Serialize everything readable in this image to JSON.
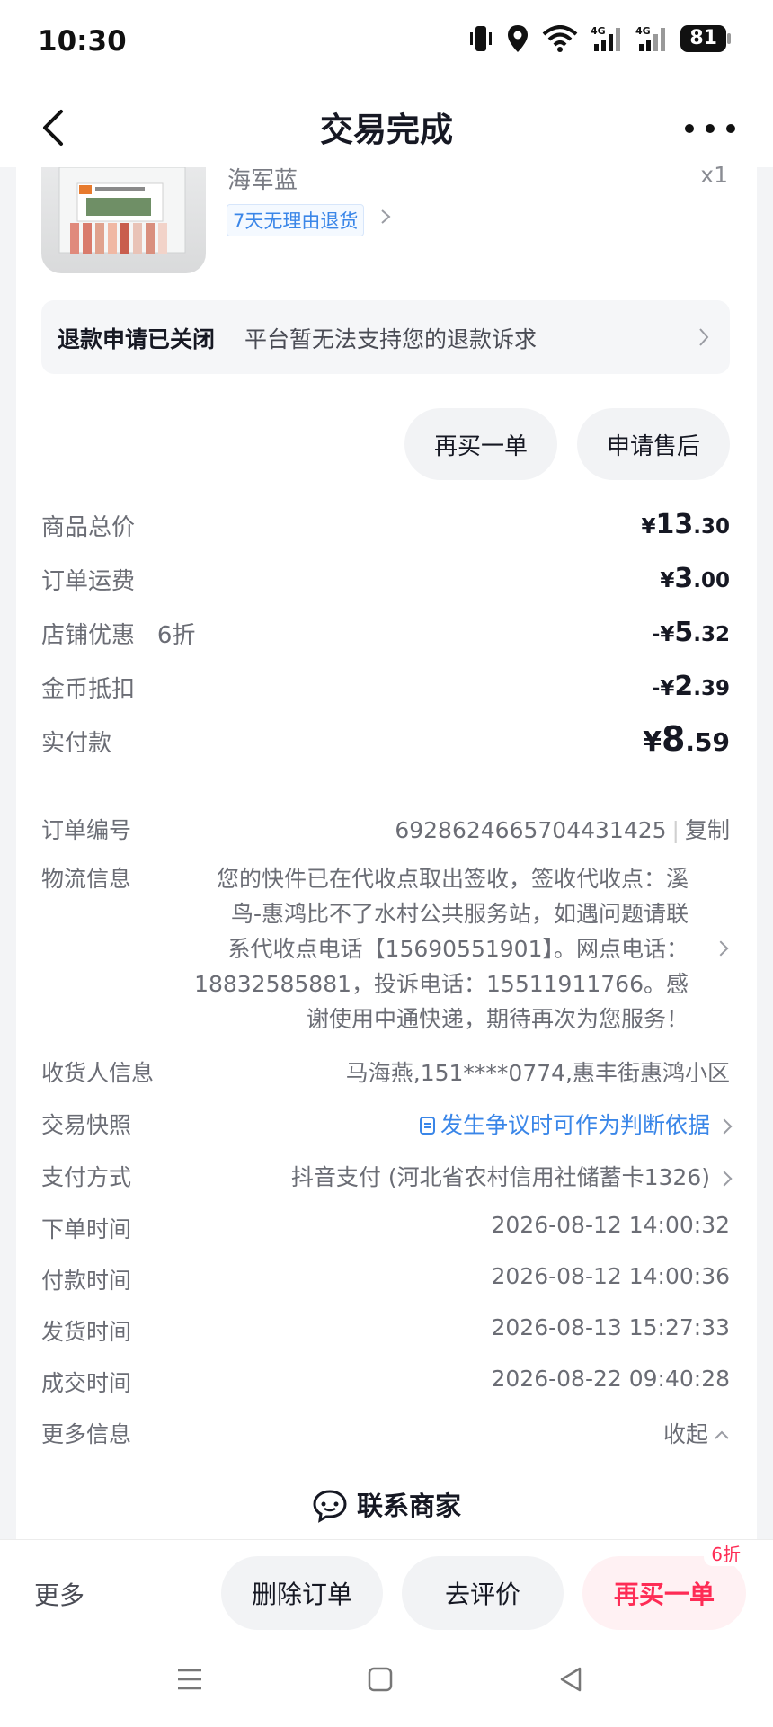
{
  "status_bar": {
    "time": "10:30",
    "battery": "81"
  },
  "header": {
    "title": "交易完成"
  },
  "product": {
    "name": "海军蓝",
    "quantity": "x1",
    "return_tag": "7天无理由退货"
  },
  "refund": {
    "status": "退款申请已关闭",
    "reason": "平台暂无法支持您的退款诉求"
  },
  "actions": {
    "buy_again": "再买一单",
    "after_sale": "申请售后"
  },
  "prices": [
    {
      "label": "商品总价",
      "extra": "",
      "prefix": "¥",
      "int": "13",
      "dec": ".30"
    },
    {
      "label": "订单运费",
      "extra": "",
      "prefix": "¥",
      "int": "3",
      "dec": ".00"
    },
    {
      "label": "店铺优惠",
      "extra": "6折",
      "prefix": "-¥",
      "int": "5",
      "dec": ".32"
    },
    {
      "label": "金币抵扣",
      "extra": "",
      "prefix": "-¥",
      "int": "2",
      "dec": ".39"
    }
  ],
  "paid": {
    "label": "实付款",
    "prefix": "¥",
    "int": "8",
    "dec": ".59"
  },
  "order": {
    "number_label": "订单编号",
    "number": "6928624665704431425",
    "copy": "复制",
    "logistics_label": "物流信息",
    "logistics_lines": [
      "您的快件已在代收点取出签收，签收代收点：溪",
      "鸟-惠鸿比不了水村公共服务站，如遇问题请联",
      "系代收点电话【15690551901】。网点电话：",
      "18832585881，投诉电话：15511911766。感",
      "谢使用中通快递，期待再次为您服务！"
    ],
    "receiver_label": "收货人信息",
    "receiver": "马海燕,151****0774,惠丰街惠鸿小区",
    "snapshot_label": "交易快照",
    "snapshot": "发生争议时可作为判断依据",
    "payment_label": "支付方式",
    "payment": "抖音支付 (河北省农村信用社储蓄卡1326)",
    "times": [
      {
        "label": "下单时间",
        "value": "2026-08-12 14:00:32"
      },
      {
        "label": "付款时间",
        "value": "2026-08-12 14:00:36"
      },
      {
        "label": "发货时间",
        "value": "2026-08-13 15:27:33"
      },
      {
        "label": "成交时间",
        "value": "2026-08-22 09:40:28"
      }
    ],
    "more_label": "更多信息",
    "collapse": "收起"
  },
  "contact": "联系商家",
  "bottom_bar": {
    "more": "更多",
    "delete": "删除订单",
    "review": "去评价",
    "buy_again": "再买一单",
    "discount": "6折"
  },
  "colors": {
    "accent": "#fe2c55",
    "link": "#3a86e8",
    "text": "#161823",
    "muted": "#6b6d75"
  }
}
